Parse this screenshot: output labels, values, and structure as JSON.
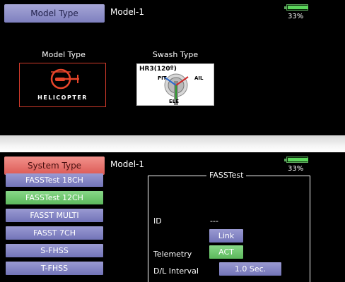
{
  "top_screen": {
    "title": "Model Type",
    "model_name": "Model-1",
    "battery_pct": "33%",
    "battery_level": 0.33,
    "model_type_label": "Model Type",
    "model_type_value": "HELICOPTER",
    "swash_type_label": "Swash Type",
    "swash": {
      "type": "HR3(120º)",
      "pit": "PIT",
      "ail": "AIL",
      "ele": "ELE"
    }
  },
  "bottom_screen": {
    "title": "System Type",
    "model_name": "Model-1",
    "battery_pct": "33%",
    "battery_level": 0.33,
    "system_types": [
      {
        "label": "FASSTest 18CH",
        "selected": false
      },
      {
        "label": "FASSTest 12CH",
        "selected": true
      },
      {
        "label": "FASST MULTI",
        "selected": false
      },
      {
        "label": "FASST 7CH",
        "selected": false
      },
      {
        "label": "S-FHSS",
        "selected": false
      },
      {
        "label": "T-FHSS",
        "selected": false
      }
    ],
    "panel": {
      "title": "FASSTest",
      "id_label": "ID",
      "id_value": "---",
      "link_button": "Link",
      "telemetry_label": "Telemetry",
      "telemetry_value": "ACT",
      "dl_interval_label": "D/L Interval",
      "dl_interval_value": "1.0 Sec."
    }
  },
  "colors": {
    "model_tab": "#8c8ec8",
    "system_tab": "#e87670",
    "button_blue": "#8486c4",
    "button_green": "#6ec86e",
    "heli_red": "#d03a2a"
  }
}
